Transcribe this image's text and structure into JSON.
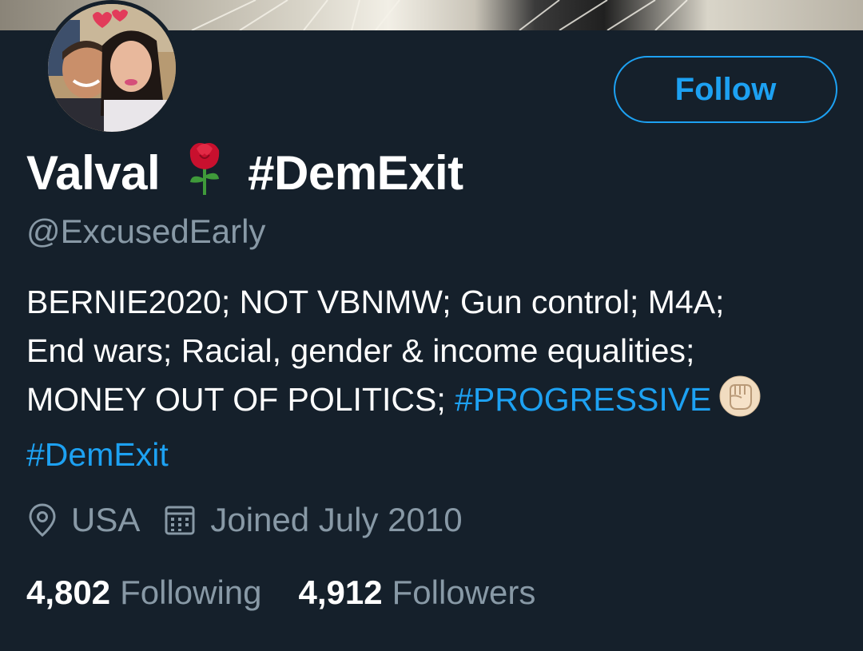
{
  "profile": {
    "name": "Valval",
    "name_hashtag": "#DemExit",
    "handle": "@ExcusedEarly",
    "follow_label": "Follow",
    "bio": {
      "line1": "BERNIE2020; NOT VBNMW; Gun control; M4A;",
      "line2": "End wars; Racial, gender & income equalities;",
      "line3_text": "MONEY OUT OF POLITICS; ",
      "line3_hashtag": "#PROGRESSIVE",
      "line4_hashtag": "#DemExit"
    },
    "location": "USA",
    "joined": "Joined July 2010",
    "following_count": "4,802",
    "following_label": "Following",
    "followers_count": "4,912",
    "followers_label": "Followers"
  },
  "icons": {
    "name_emoji": "rose-icon",
    "bio_emoji": "raised-fist-icon",
    "location": "location-pin-icon",
    "joined": "calendar-icon"
  },
  "colors": {
    "background": "#15202b",
    "accent": "#1da1f2",
    "secondary_text": "#8899a6",
    "primary_text": "#ffffff"
  }
}
